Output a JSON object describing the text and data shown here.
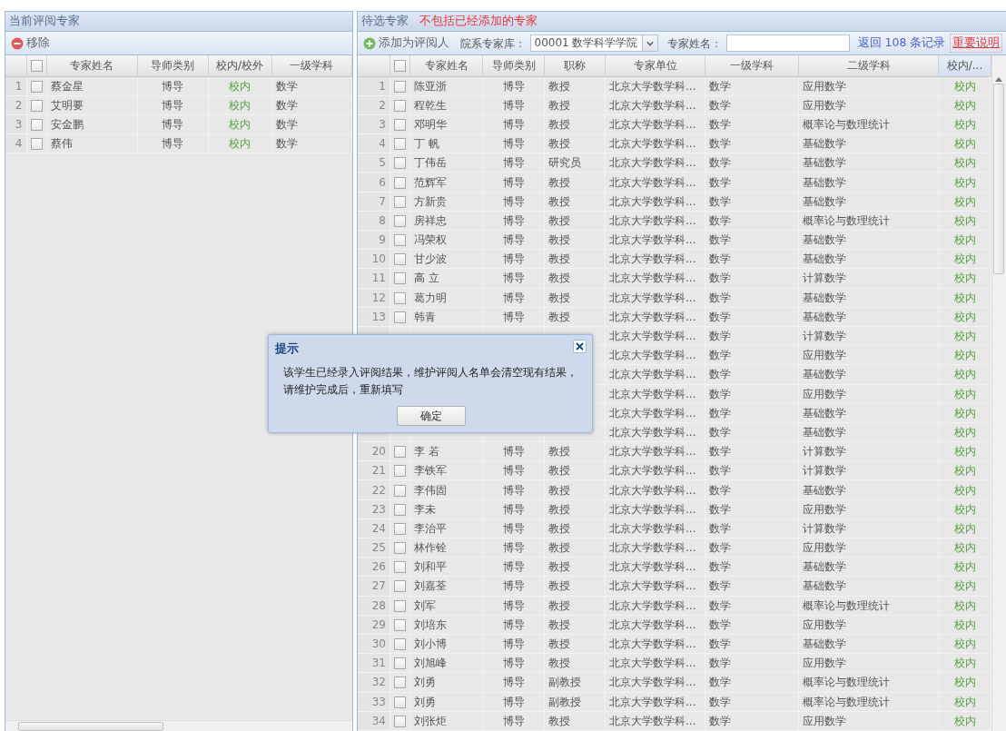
{
  "left_panel": {
    "title": "当前评阅专家",
    "toolbar": [
      {
        "kind": "remove",
        "label": "移除"
      }
    ],
    "header_checked": false,
    "columns": [
      "专家姓名",
      "导师类别",
      "校内/校外",
      "一级学科"
    ],
    "rows": [
      {
        "index": "1",
        "checked": false,
        "name": "蔡金星",
        "tutor_type": "博导",
        "campus": "校内",
        "discipline": "数学"
      },
      {
        "index": "2",
        "checked": false,
        "name": "艾明要",
        "tutor_type": "博导",
        "campus": "校内",
        "discipline": "数学"
      },
      {
        "index": "3",
        "checked": false,
        "name": "安金鹏",
        "tutor_type": "博导",
        "campus": "校内",
        "discipline": "数学"
      },
      {
        "index": "4",
        "checked": false,
        "name": "蔡伟",
        "tutor_type": "博导",
        "campus": "校内",
        "discipline": "数学"
      }
    ]
  },
  "right_panel": {
    "title": "待选专家",
    "note": "不包括已经添加的专家",
    "toolbar": {
      "add_button": "添加为评阅人",
      "library_label": "院系专家库：",
      "library_value": "00001 数学科学学院",
      "name_label": "专家姓名：",
      "record_count": "返回 108 条记录",
      "help_link": "重要说明"
    },
    "header_checked": false,
    "columns": [
      "专家姓名",
      "导师类别",
      "职称",
      "专家单位",
      "一级学科",
      "二级学科",
      "校内/..."
    ],
    "rows": [
      {
        "index": "1",
        "checked": false,
        "name": "陈亚浙",
        "tutor_type": "博导",
        "title": "教授",
        "unit": "北京大学数学科...",
        "discipline": "数学",
        "subdiscipline": "应用数学",
        "campus": "校内"
      },
      {
        "index": "2",
        "checked": false,
        "name": "程乾生",
        "tutor_type": "博导",
        "title": "教授",
        "unit": "北京大学数学科...",
        "discipline": "数学",
        "subdiscipline": "应用数学",
        "campus": "校内"
      },
      {
        "index": "3",
        "checked": false,
        "name": "邓明华",
        "tutor_type": "博导",
        "title": "教授",
        "unit": "北京大学数学科...",
        "discipline": "数学",
        "subdiscipline": "概率论与数理统计",
        "campus": "校内"
      },
      {
        "index": "4",
        "checked": false,
        "name": "丁 帆",
        "tutor_type": "博导",
        "title": "教授",
        "unit": "北京大学数学科...",
        "discipline": "数学",
        "subdiscipline": "基础数学",
        "campus": "校内"
      },
      {
        "index": "5",
        "checked": false,
        "name": "丁伟岳",
        "tutor_type": "博导",
        "title": "研究员",
        "unit": "北京大学数学科...",
        "discipline": "数学",
        "subdiscipline": "基础数学",
        "campus": "校内"
      },
      {
        "index": "6",
        "checked": false,
        "name": "范辉军",
        "tutor_type": "博导",
        "title": "教授",
        "unit": "北京大学数学科...",
        "discipline": "数学",
        "subdiscipline": "基础数学",
        "campus": "校内"
      },
      {
        "index": "7",
        "checked": false,
        "name": "方新贵",
        "tutor_type": "博导",
        "title": "教授",
        "unit": "北京大学数学科...",
        "discipline": "数学",
        "subdiscipline": "基础数学",
        "campus": "校内"
      },
      {
        "index": "8",
        "checked": false,
        "name": "房祥忠",
        "tutor_type": "博导",
        "title": "教授",
        "unit": "北京大学数学科...",
        "discipline": "数学",
        "subdiscipline": "概率论与数理统计",
        "campus": "校内"
      },
      {
        "index": "9",
        "checked": false,
        "name": "冯荣权",
        "tutor_type": "博导",
        "title": "教授",
        "unit": "北京大学数学科...",
        "discipline": "数学",
        "subdiscipline": "基础数学",
        "campus": "校内"
      },
      {
        "index": "10",
        "checked": false,
        "name": "甘少波",
        "tutor_type": "博导",
        "title": "教授",
        "unit": "北京大学数学科...",
        "discipline": "数学",
        "subdiscipline": "基础数学",
        "campus": "校内"
      },
      {
        "index": "11",
        "checked": false,
        "name": "高 立",
        "tutor_type": "博导",
        "title": "教授",
        "unit": "北京大学数学科...",
        "discipline": "数学",
        "subdiscipline": "计算数学",
        "campus": "校内"
      },
      {
        "index": "12",
        "checked": false,
        "name": "葛力明",
        "tutor_type": "博导",
        "title": "教授",
        "unit": "北京大学数学科...",
        "discipline": "数学",
        "subdiscipline": "基础数学",
        "campus": "校内"
      },
      {
        "index": "13",
        "checked": false,
        "name": "韩青",
        "tutor_type": "博导",
        "title": "教授",
        "unit": "北京大学数学科...",
        "discipline": "数学",
        "subdiscipline": "基础数学",
        "campus": "校内"
      },
      {
        "unit": "北京大学数学科...",
        "discipline": "数学",
        "subdiscipline": "计算数学",
        "campus": "校内"
      },
      {
        "unit": "北京大学数学科...",
        "discipline": "数学",
        "subdiscipline": "应用数学",
        "campus": "校内"
      },
      {
        "unit": "北京大学数学科...",
        "discipline": "数学",
        "subdiscipline": "基础数学",
        "campus": "校内"
      },
      {
        "unit": "北京大学数学科...",
        "discipline": "数学",
        "subdiscipline": "应用数学",
        "campus": "校内"
      },
      {
        "unit": "北京大学数学科...",
        "discipline": "数学",
        "subdiscipline": "基础数学",
        "campus": "校内"
      },
      {
        "unit": "北京大学数学科...",
        "discipline": "数学",
        "subdiscipline": "基础数学",
        "campus": "校内"
      },
      {
        "index": "20",
        "checked": false,
        "name": "李 若",
        "tutor_type": "博导",
        "title": "教授",
        "unit": "北京大学数学科...",
        "discipline": "数学",
        "subdiscipline": "计算数学",
        "campus": "校内"
      },
      {
        "index": "21",
        "checked": false,
        "name": "李铁军",
        "tutor_type": "博导",
        "title": "教授",
        "unit": "北京大学数学科...",
        "discipline": "数学",
        "subdiscipline": "计算数学",
        "campus": "校内"
      },
      {
        "index": "22",
        "checked": false,
        "name": "李伟固",
        "tutor_type": "博导",
        "title": "教授",
        "unit": "北京大学数学科...",
        "discipline": "数学",
        "subdiscipline": "基础数学",
        "campus": "校内"
      },
      {
        "index": "23",
        "checked": false,
        "name": "李未",
        "tutor_type": "博导",
        "title": "教授",
        "unit": "北京大学数学科...",
        "discipline": "数学",
        "subdiscipline": "应用数学",
        "campus": "校内"
      },
      {
        "index": "24",
        "checked": false,
        "name": "李治平",
        "tutor_type": "博导",
        "title": "教授",
        "unit": "北京大学数学科...",
        "discipline": "数学",
        "subdiscipline": "计算数学",
        "campus": "校内"
      },
      {
        "index": "25",
        "checked": false,
        "name": "林作铨",
        "tutor_type": "博导",
        "title": "教授",
        "unit": "北京大学数学科...",
        "discipline": "数学",
        "subdiscipline": "应用数学",
        "campus": "校内"
      },
      {
        "index": "26",
        "checked": false,
        "name": "刘和平",
        "tutor_type": "博导",
        "title": "教授",
        "unit": "北京大学数学科...",
        "discipline": "数学",
        "subdiscipline": "基础数学",
        "campus": "校内"
      },
      {
        "index": "27",
        "checked": false,
        "name": "刘嘉荃",
        "tutor_type": "博导",
        "title": "教授",
        "unit": "北京大学数学科...",
        "discipline": "数学",
        "subdiscipline": "基础数学",
        "campus": "校内"
      },
      {
        "index": "28",
        "checked": false,
        "name": "刘军",
        "tutor_type": "博导",
        "title": "教授",
        "unit": "北京大学数学科...",
        "discipline": "数学",
        "subdiscipline": "概率论与数理统计",
        "campus": "校内"
      },
      {
        "index": "29",
        "checked": false,
        "name": "刘培东",
        "tutor_type": "博导",
        "title": "教授",
        "unit": "北京大学数学科...",
        "discipline": "数学",
        "subdiscipline": "应用数学",
        "campus": "校内"
      },
      {
        "index": "30",
        "checked": false,
        "name": "刘小博",
        "tutor_type": "博导",
        "title": "教授",
        "unit": "北京大学数学科...",
        "discipline": "数学",
        "subdiscipline": "基础数学",
        "campus": "校内"
      },
      {
        "index": "31",
        "checked": false,
        "name": "刘旭峰",
        "tutor_type": "博导",
        "title": "教授",
        "unit": "北京大学数学科...",
        "discipline": "数学",
        "subdiscipline": "应用数学",
        "campus": "校内"
      },
      {
        "index": "32",
        "checked": false,
        "name": "刘勇",
        "tutor_type": "博导",
        "title": "副教授",
        "unit": "北京大学数学科...",
        "discipline": "数学",
        "subdiscipline": "概率论与数理统计",
        "campus": "校内"
      },
      {
        "index": "33",
        "checked": false,
        "name": "刘勇",
        "tutor_type": "博导",
        "title": "副教授",
        "unit": "北京大学数学科...",
        "discipline": "数学",
        "subdiscipline": "概率论与数理统计",
        "campus": "校内"
      },
      {
        "index": "34",
        "checked": false,
        "name": "刘张炬",
        "tutor_type": "博导",
        "title": "教授",
        "unit": "北京大学数学科...",
        "discipline": "数学",
        "subdiscipline": "应用数学",
        "campus": "校内"
      }
    ]
  },
  "dialog": {
    "title": "提示",
    "message": [
      "该学生已经录入评阅结果，维护评阅人名单会清空现有结果，",
      "请维护完成后，重新填写"
    ],
    "ok_button": "确定"
  }
}
